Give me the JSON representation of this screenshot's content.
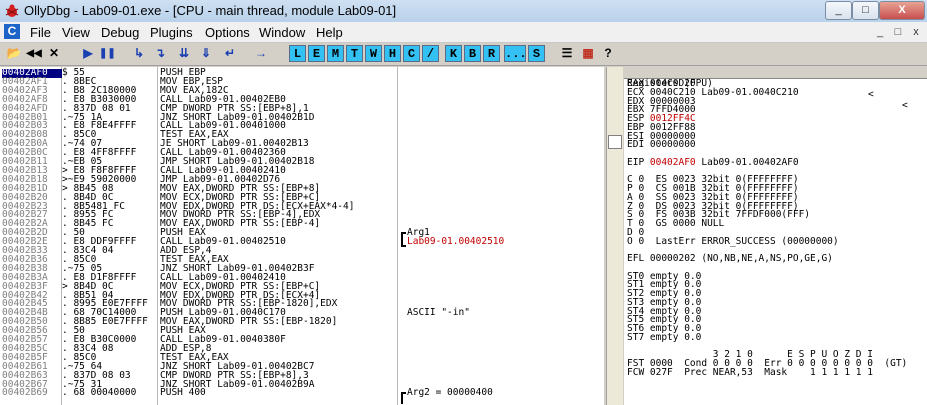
{
  "window": {
    "title": "OllyDbg - Lab09-01.exe - [CPU - main thread, module Lab09-01]"
  },
  "menu": [
    "File",
    "View",
    "Debug",
    "Plugins",
    "Options",
    "Window",
    "Help"
  ],
  "window_buttons": {
    "min": "_",
    "max": "□",
    "close": "X",
    "mdi_min": "_",
    "mdi_max": "□",
    "mdi_close": "x"
  },
  "toolbar": {
    "icons": [
      "open-icon",
      "rewind-icon",
      "close-x-icon",
      "run-icon",
      "pause-icon",
      "step-into-icon",
      "step-over-icon",
      "trace-into-icon",
      "trace-over-icon",
      "execute-till-return-icon",
      "goto-icon"
    ],
    "glyphs": [
      "📂",
      "◀◀",
      "✕",
      "▶",
      "❚❚",
      "↳",
      "↴",
      "⇊",
      "⇓",
      "↵",
      "→"
    ],
    "letters": [
      "L",
      "E",
      "M",
      "T",
      "W",
      "H",
      "C",
      "/",
      "K",
      "B",
      "R",
      "...",
      "S"
    ],
    "right_glyphs": [
      "☰",
      "▦",
      "?"
    ],
    "accent": "#33c0f2"
  },
  "disasm_rows": [
    {
      "a": "00402AF0",
      "h": "$ 55",
      "i": "PUSH EBP",
      "c": ""
    },
    {
      "a": "00402AF1",
      "h": ". 8BEC",
      "i": "MOV EBP,ESP",
      "c": ""
    },
    {
      "a": "00402AF3",
      "h": ". B8 2C180000",
      "i": "MOV EAX,182C",
      "c": ""
    },
    {
      "a": "00402AF8",
      "h": ". E8 B3030000",
      "i": "CALL Lab09-01.00402EB0",
      "c": ""
    },
    {
      "a": "00402AFD",
      "h": ". 837D 08 01",
      "i": "CMP DWORD PTR SS:[EBP+8],1",
      "c": ""
    },
    {
      "a": "00402B01",
      "h": ".~75 1A",
      "i": "JNZ SHORT Lab09-01.00402B1D",
      "c": ""
    },
    {
      "a": "00402B03",
      "h": ". E8 F8E4FFFF",
      "i": "CALL Lab09-01.00401000",
      "c": ""
    },
    {
      "a": "00402B08",
      "h": ". 85C0",
      "i": "TEST EAX,EAX",
      "c": ""
    },
    {
      "a": "00402B0A",
      "h": ".~74 07",
      "i": "JE SHORT Lab09-01.00402B13",
      "c": ""
    },
    {
      "a": "00402B0C",
      "h": ". E8 4FF8FFFF",
      "i": "CALL Lab09-01.00402360",
      "c": ""
    },
    {
      "a": "00402B11",
      "h": ".~EB 05",
      "i": "JMP SHORT Lab09-01.00402B18",
      "c": ""
    },
    {
      "a": "00402B13",
      "h": "> E8 F8F8FFFF",
      "i": "CALL Lab09-01.00402410",
      "c": ""
    },
    {
      "a": "00402B18",
      "h": ">~E9 59020000",
      "i": "JMP Lab09-01.00402D76",
      "c": ""
    },
    {
      "a": "00402B1D",
      "h": "> 8B45 08",
      "i": "MOV EAX,DWORD PTR SS:[EBP+8]",
      "c": ""
    },
    {
      "a": "00402B20",
      "h": ". 8B4D 0C",
      "i": "MOV ECX,DWORD PTR SS:[EBP+C]",
      "c": ""
    },
    {
      "a": "00402B23",
      "h": ". 8B5481 FC",
      "i": "MOV EDX,DWORD PTR DS:[ECX+EAX*4-4]",
      "c": ""
    },
    {
      "a": "00402B27",
      "h": ". 8955 FC",
      "i": "MOV DWORD PTR SS:[EBP-4],EDX",
      "c": ""
    },
    {
      "a": "00402B2A",
      "h": ". 8B45 FC",
      "i": "MOV EAX,DWORD PTR SS:[EBP-4]",
      "c": ""
    },
    {
      "a": "00402B2D",
      "h": ". 50",
      "i": "PUSH EAX",
      "c": "Arg1"
    },
    {
      "a": "00402B2E",
      "h": ". E8 DDF9FFFF",
      "i": "CALL Lab09-01.00402510",
      "c": "Lab09-01.00402510"
    },
    {
      "a": "00402B33",
      "h": ". 83C4 04",
      "i": "ADD ESP,4",
      "c": ""
    },
    {
      "a": "00402B36",
      "h": ". 85C0",
      "i": "TEST EAX,EAX",
      "c": ""
    },
    {
      "a": "00402B38",
      "h": ".~75 05",
      "i": "JNZ SHORT Lab09-01.00402B3F",
      "c": ""
    },
    {
      "a": "00402B3A",
      "h": ". E8 D1F8FFFF",
      "i": "CALL Lab09-01.00402410",
      "c": ""
    },
    {
      "a": "00402B3F",
      "h": "> 8B4D 0C",
      "i": "MOV ECX,DWORD PTR SS:[EBP+C]",
      "c": ""
    },
    {
      "a": "00402B42",
      "h": ". 8B51 04",
      "i": "MOV EDX,DWORD PTR DS:[ECX+4]",
      "c": ""
    },
    {
      "a": "00402B45",
      "h": ". 8995 E0E7FFFF",
      "i": "MOV DWORD PTR SS:[EBP-1820],EDX",
      "c": ""
    },
    {
      "a": "00402B4B",
      "h": ". 68 70C14000",
      "i": "PUSH Lab09-01.0040C170",
      "c": "ASCII \"-in\""
    },
    {
      "a": "00402B50",
      "h": ". 8B85 E0E7FFFF",
      "i": "MOV EAX,DWORD PTR SS:[EBP-1820]",
      "c": ""
    },
    {
      "a": "00402B56",
      "h": ". 50",
      "i": "PUSH EAX",
      "c": ""
    },
    {
      "a": "00402B57",
      "h": ". E8 B30C0000",
      "i": "CALL Lab09-01.0040380F",
      "c": ""
    },
    {
      "a": "00402B5C",
      "h": ". 83C4 08",
      "i": "ADD ESP,8",
      "c": ""
    },
    {
      "a": "00402B5F",
      "h": ". 85C0",
      "i": "TEST EAX,EAX",
      "c": ""
    },
    {
      "a": "00402B61",
      "h": ".~75 64",
      "i": "JNZ SHORT Lab09-01.00402BC7",
      "c": ""
    },
    {
      "a": "00402B63",
      "h": ". 837D 08 03",
      "i": "CMP DWORD PTR SS:[EBP+8],3",
      "c": ""
    },
    {
      "a": "00402B67",
      "h": ".~75 31",
      "i": "JNZ SHORT Lab09-01.00402B9A",
      "c": ""
    },
    {
      "a": "00402B69",
      "h": ". 68 00040000",
      "i": "PUSH 400",
      "c": "Arg2 = 00000400"
    }
  ],
  "registers": {
    "header": "Registers (FPU)",
    "header_arrows": [
      "<",
      "<"
    ],
    "rows": [
      {
        "t": "EAX 004C0D20"
      },
      {
        "t": "ECX 0040C210 Lab09-01.0040C210"
      },
      {
        "t": "EDX 00000003"
      },
      {
        "t": "EBX 7FFD4000"
      },
      {
        "t": "ESP ",
        "r": "0012FF4C"
      },
      {
        "t": "EBP 0012FF88"
      },
      {
        "t": "ESI 00000000"
      },
      {
        "t": "EDI 00000000"
      },
      {
        "t": ""
      },
      {
        "t": "EIP ",
        "r": "00402AF0",
        "t2": " Lab09-01.00402AF0"
      },
      {
        "t": ""
      },
      {
        "t": "C 0  ES 0023 32bit 0(FFFFFFFF)"
      },
      {
        "t": "P 0  CS 001B 32bit 0(FFFFFFFF)"
      },
      {
        "t": "A 0  SS 0023 32bit 0(FFFFFFFF)"
      },
      {
        "t": "Z 0  DS 0023 32bit 0(FFFFFFFF)"
      },
      {
        "t": "S 0  FS 003B 32bit 7FFDF000(FFF)"
      },
      {
        "t": "T 0  GS 0000 NULL"
      },
      {
        "t": "D 0"
      },
      {
        "t": "O 0  LastErr ERROR_SUCCESS (00000000)"
      },
      {
        "t": ""
      },
      {
        "t": "EFL 00000202 (NO,NB,NE,A,NS,PO,GE,G)"
      },
      {
        "t": ""
      },
      {
        "t": "ST0 empty 0.0"
      },
      {
        "t": "ST1 empty 0.0"
      },
      {
        "t": "ST2 empty 0.0"
      },
      {
        "t": "ST3 empty 0.0"
      },
      {
        "t": "ST4 empty 0.0"
      },
      {
        "t": "ST5 empty 0.0"
      },
      {
        "t": "ST6 empty 0.0"
      },
      {
        "t": "ST7 empty 0.0"
      },
      {
        "t": ""
      },
      {
        "t": "               3 2 1 0      E S P U O Z D I"
      },
      {
        "t": "FST 0000  Cond 0 0 0 0  Err 0 0 0 0 0 0 0 0  (GT)"
      },
      {
        "t": "FCW 027F  Prec NEAR,53  Mask    1 1 1 1 1 1"
      }
    ]
  },
  "colors": {
    "red": "#c00000",
    "selection": "#000080"
  }
}
